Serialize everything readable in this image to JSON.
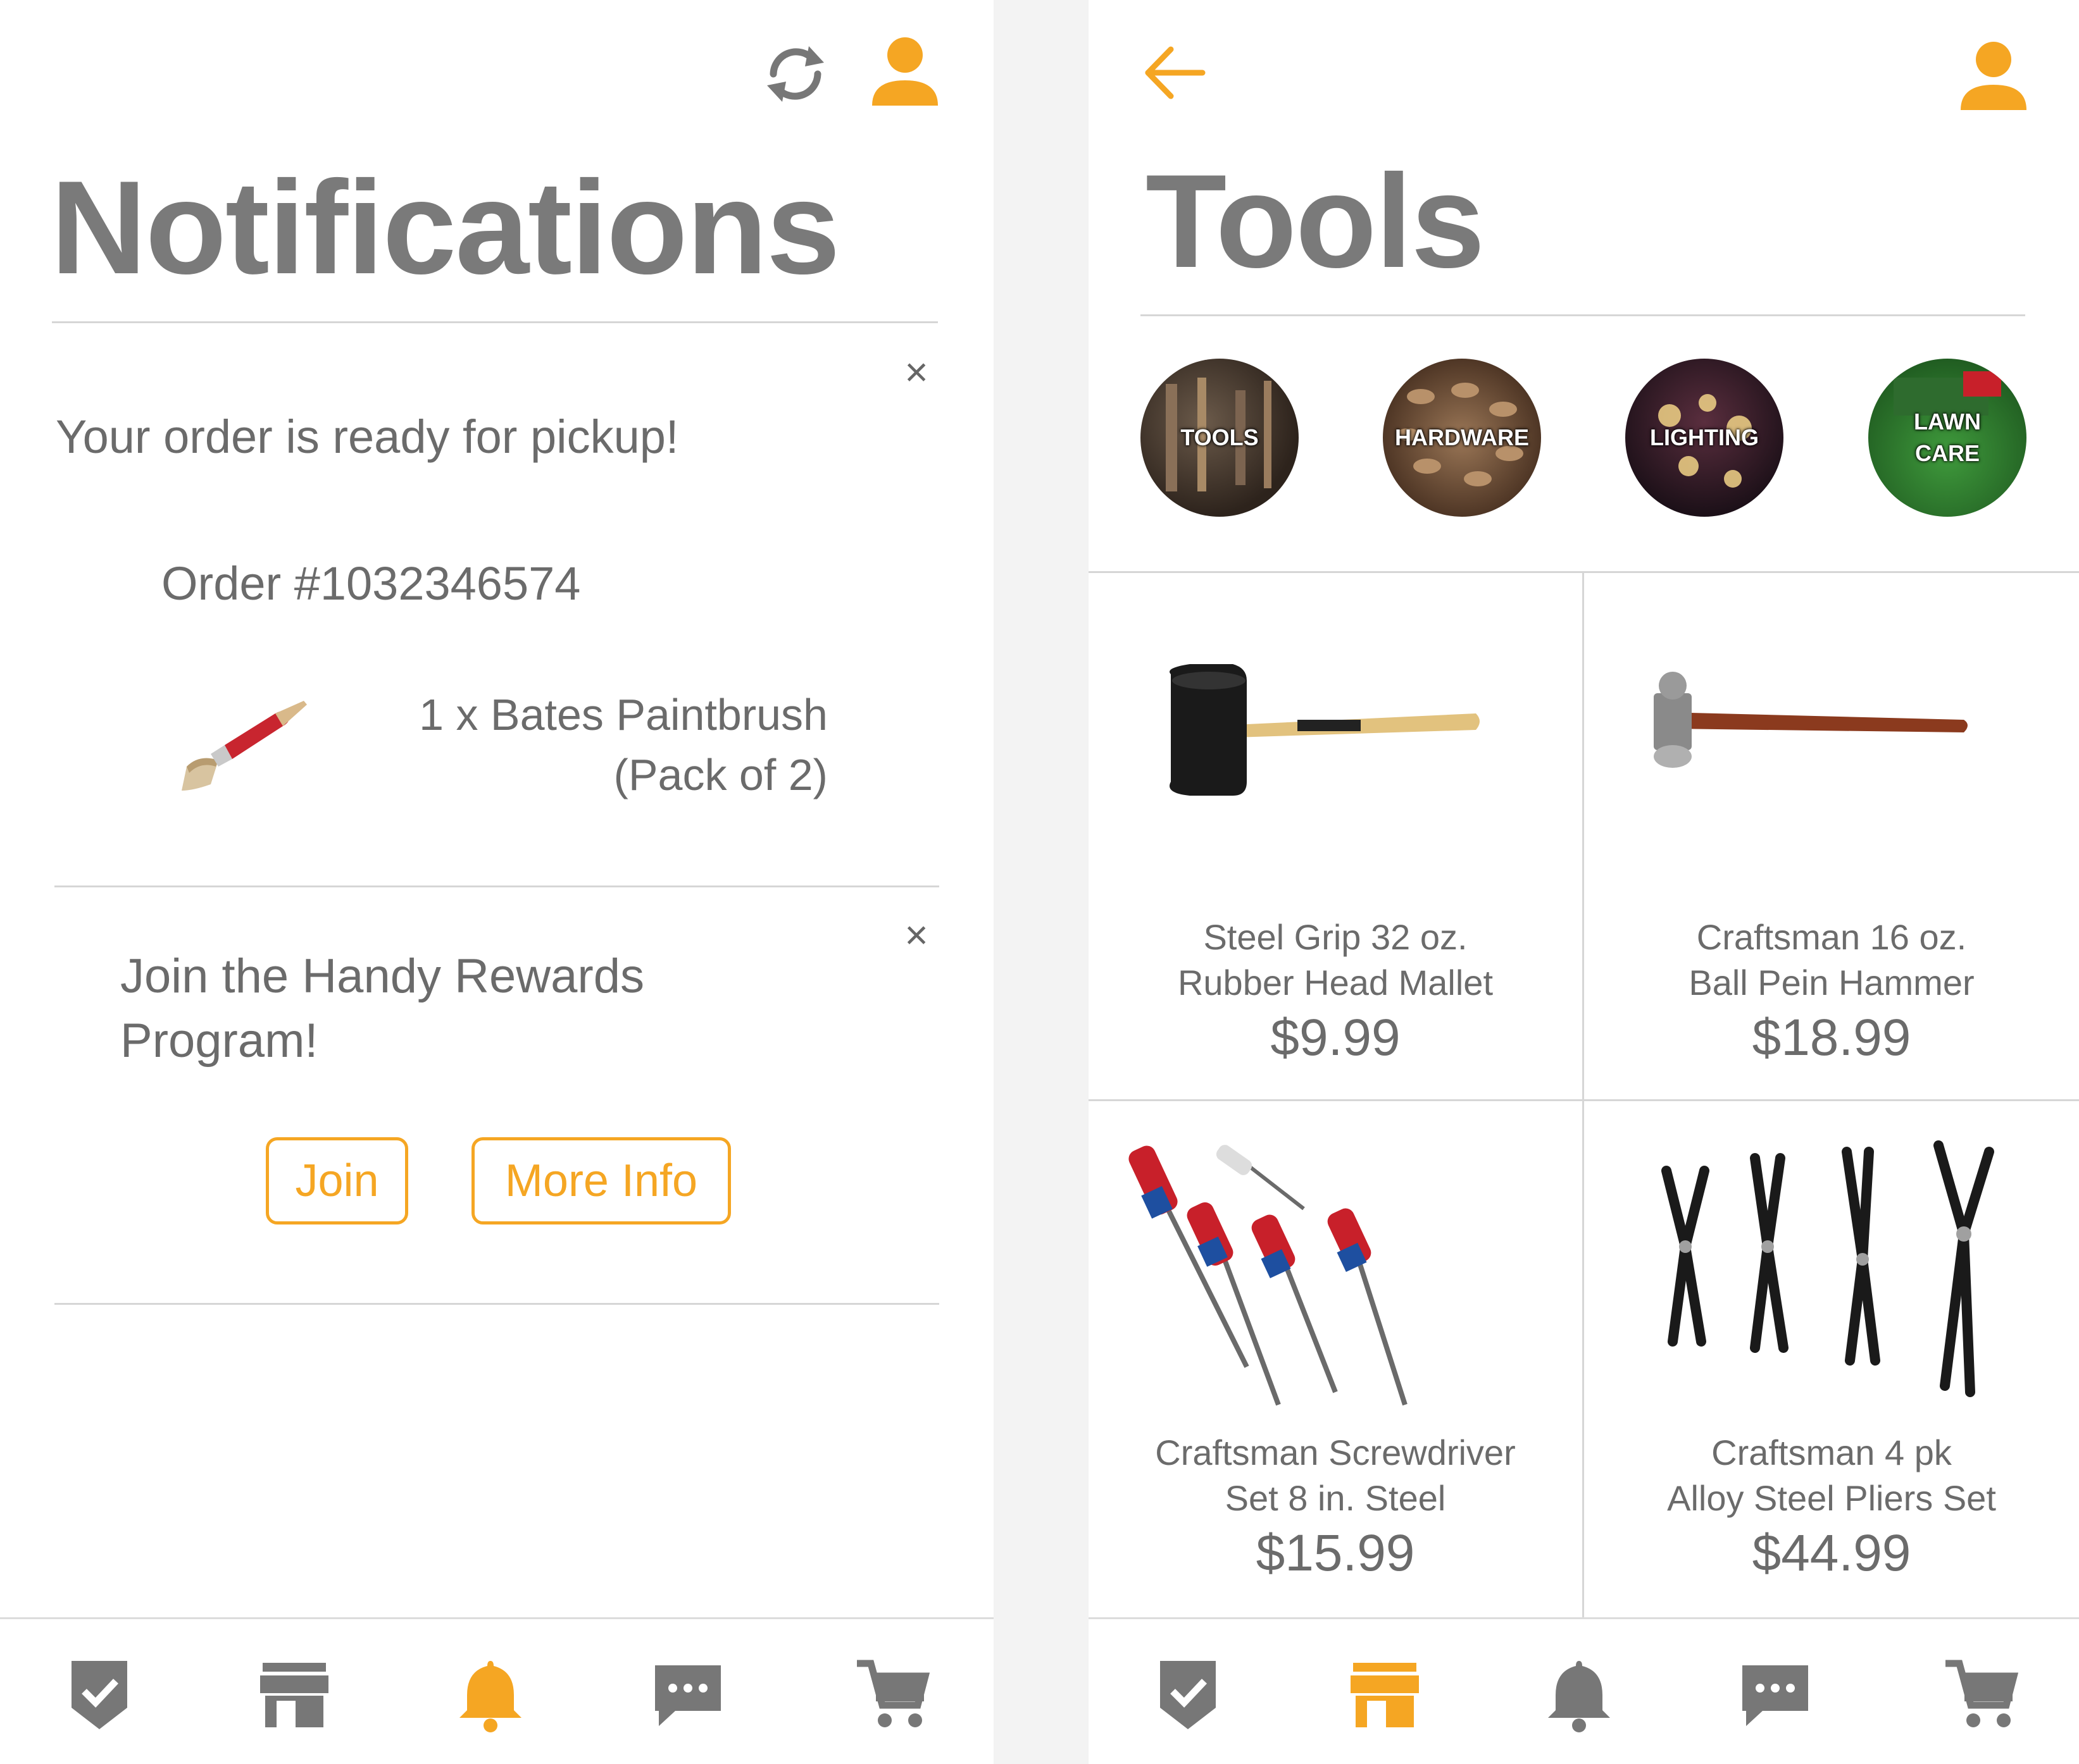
{
  "colors": {
    "accent": "#f5a623",
    "icon_gray": "#777777",
    "text_gray": "#6b6b6b"
  },
  "notifications_screen": {
    "title": "Notifications",
    "top_icons": [
      "refresh-icon",
      "profile-icon"
    ],
    "order_card": {
      "headline": "Your order is ready for pickup!",
      "order_number": "Order #1032346574",
      "item_line1": "1 x Bates Paintbrush",
      "item_line2": "(Pack of 2)",
      "close": "×"
    },
    "rewards_card": {
      "headline_line1": "Join the Handy Rewards",
      "headline_line2": "Program!",
      "join_label": "Join",
      "more_info_label": "More Info",
      "close": "×"
    },
    "active_tab": "notifications"
  },
  "tools_screen": {
    "title": "Tools",
    "top_icons": [
      "back-arrow-icon",
      "profile-icon"
    ],
    "categories": [
      {
        "label": "TOOLS"
      },
      {
        "label": "HARDWARE"
      },
      {
        "label": "LIGHTING"
      },
      {
        "label": "LAWN\nCARE"
      }
    ],
    "products": [
      {
        "name_line1": "Steel Grip 32 oz.",
        "name_line2": "Rubber Head Mallet",
        "price": "$9.99"
      },
      {
        "name_line1": "Craftsman 16 oz.",
        "name_line2": "Ball Pein Hammer",
        "price": "$18.99"
      },
      {
        "name_line1": "Craftsman Screwdriver",
        "name_line2": "Set 8 in. Steel",
        "price": "$15.99"
      },
      {
        "name_line1": "Craftsman 4 pk",
        "name_line2": "Alloy Steel Pliers Set",
        "price": "$44.99"
      }
    ],
    "active_tab": "store"
  },
  "bottom_nav": [
    "checklist-icon",
    "store-icon",
    "bell-icon",
    "chat-icon",
    "cart-icon"
  ]
}
